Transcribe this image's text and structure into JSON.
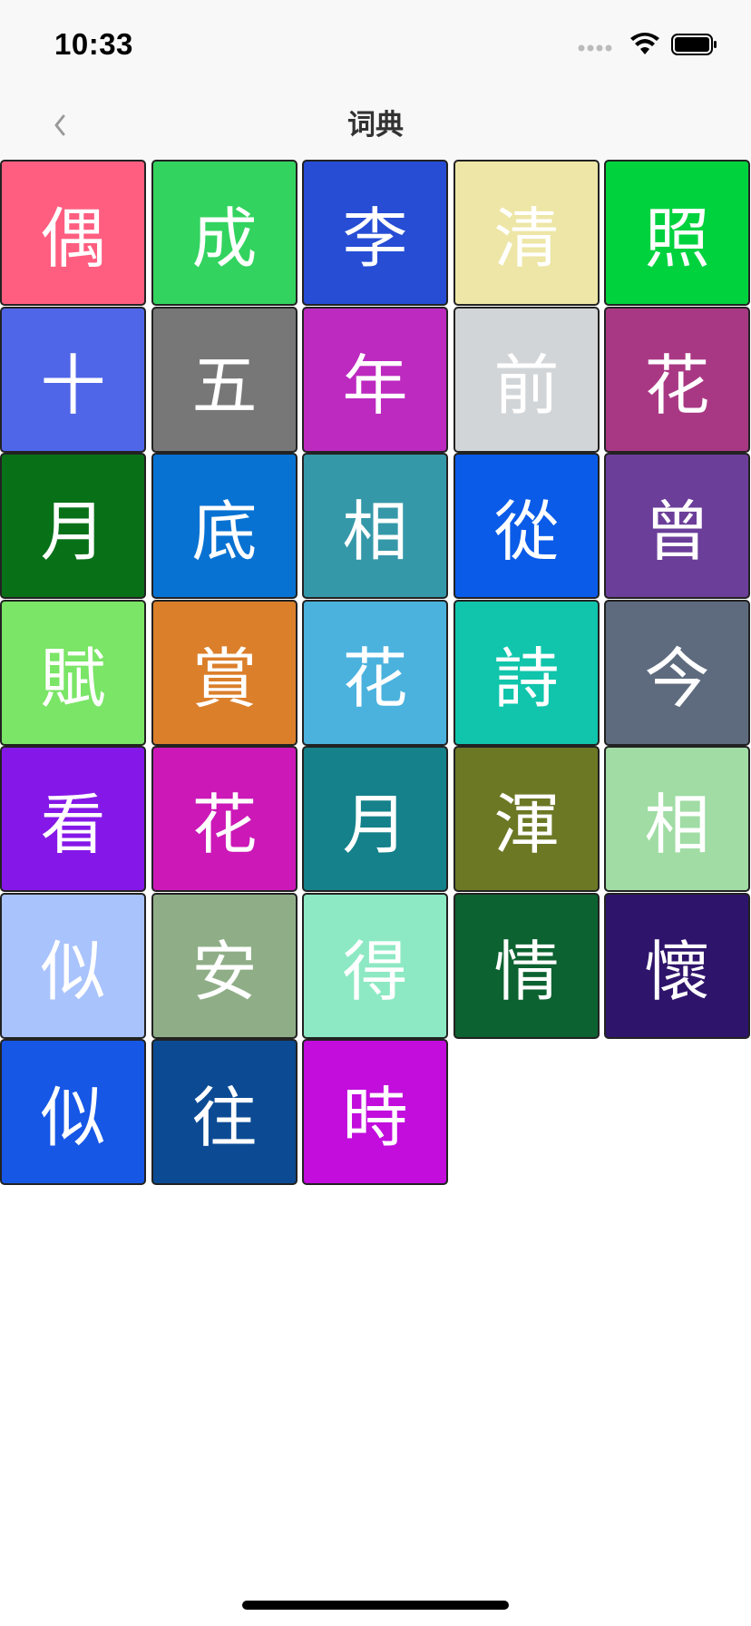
{
  "status": {
    "time": "10:33"
  },
  "nav": {
    "title": "词典"
  },
  "tiles": [
    {
      "char": "偶",
      "color": "#ff5e80"
    },
    {
      "char": "成",
      "color": "#33d35f"
    },
    {
      "char": "李",
      "color": "#264dd4"
    },
    {
      "char": "清",
      "color": "#ede6a6"
    },
    {
      "char": "照",
      "color": "#00d23e"
    },
    {
      "char": "十",
      "color": "#5066e8"
    },
    {
      "char": "五",
      "color": "#777777"
    },
    {
      "char": "年",
      "color": "#bd2ac0"
    },
    {
      "char": "前",
      "color": "#d1d5d8"
    },
    {
      "char": "花",
      "color": "#a93884"
    },
    {
      "char": "月",
      "color": "#087118"
    },
    {
      "char": "底",
      "color": "#0872d2"
    },
    {
      "char": "相",
      "color": "#3598a9"
    },
    {
      "char": "從",
      "color": "#0a5be8"
    },
    {
      "char": "曾",
      "color": "#6b3e9a"
    },
    {
      "char": "賦",
      "color": "#7ae566"
    },
    {
      "char": "賞",
      "color": "#db7f2b"
    },
    {
      "char": "花",
      "color": "#4bb2de"
    },
    {
      "char": "詩",
      "color": "#10c5ab"
    },
    {
      "char": "今",
      "color": "#5e6b7e"
    },
    {
      "char": "看",
      "color": "#8518e8"
    },
    {
      "char": "花",
      "color": "#cb18b7"
    },
    {
      "char": "月",
      "color": "#15818a"
    },
    {
      "char": "渾",
      "color": "#6d7825"
    },
    {
      "char": "相",
      "color": "#a0dca4"
    },
    {
      "char": "似",
      "color": "#a9c3fc"
    },
    {
      "char": "安",
      "color": "#8fae87"
    },
    {
      "char": "得",
      "color": "#8de9c3"
    },
    {
      "char": "情",
      "color": "#0c6230"
    },
    {
      "char": "懷",
      "color": "#2f146b"
    },
    {
      "char": "似",
      "color": "#1757e6"
    },
    {
      "char": "往",
      "color": "#0c4b94"
    },
    {
      "char": "時",
      "color": "#c20ddd"
    }
  ]
}
